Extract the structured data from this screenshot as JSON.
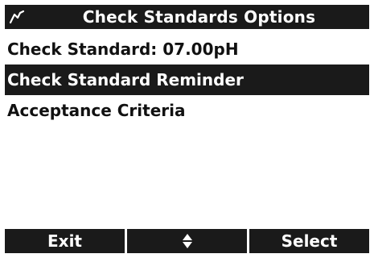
{
  "header": {
    "icon": "probe-graph-icon",
    "title": "Check Standards Options"
  },
  "menu": {
    "items": [
      {
        "label": "Check Standard: 07.00pH"
      },
      {
        "label": "Check Standard Reminder"
      },
      {
        "label": "Acceptance Criteria"
      }
    ],
    "selected_index": 1
  },
  "softkeys": {
    "left": "Exit",
    "center_icon": "up-down-arrows-icon",
    "right": "Select"
  },
  "colors": {
    "bar_background": "#1a1a1a",
    "bar_text": "#ffffff",
    "screen_background": "#ffffff",
    "body_text": "#111111"
  }
}
